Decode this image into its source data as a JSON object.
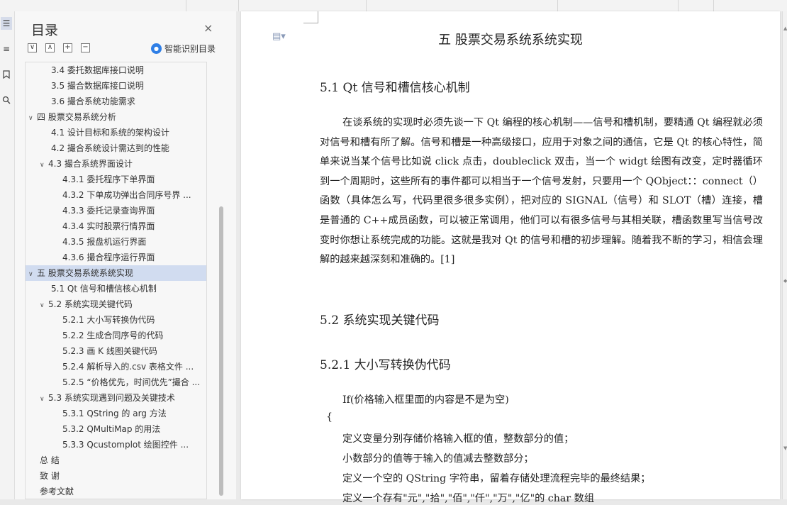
{
  "nav": {
    "title": "目录",
    "close": "×",
    "tools": [
      "∨",
      "∧",
      "+",
      "−"
    ],
    "smart_label": "智能识别目录",
    "smart_icon": "ai-icon",
    "items": [
      {
        "text": "3.4  委托数据库接口说明",
        "level": 2
      },
      {
        "text": "3.5  撮合数据库接口说明",
        "level": 2
      },
      {
        "text": "3.6  撮合系统功能需求",
        "level": 2
      },
      {
        "text": "四  股票交易系统分析",
        "level": 1,
        "expanded": true
      },
      {
        "text": "4.1  设计目标和系统的架构设计",
        "level": 2
      },
      {
        "text": "4.2  撮合系统设计需达到的性能",
        "level": 2
      },
      {
        "text": "4.3  撮合系统界面设计",
        "level": 2,
        "expanded": true
      },
      {
        "text": "4.3.1  委托程序下单界面",
        "level": 3
      },
      {
        "text": "4.3.2  下单成功弹出合同序号界 ...",
        "level": 3
      },
      {
        "text": "4.3.3  委托记录查询界面",
        "level": 3
      },
      {
        "text": "4.3.4  实时股票行情界面",
        "level": 3
      },
      {
        "text": "4.3.5  报盘机运行界面",
        "level": 3
      },
      {
        "text": "4.3.6  撮合程序运行界面",
        "level": 3
      },
      {
        "text": "五  股票交易系统系统实现",
        "level": 1,
        "expanded": true,
        "selected": true
      },
      {
        "text": "5.1 Qt 信号和槽信核心机制",
        "level": 2
      },
      {
        "text": "5.2  系统实现关键代码",
        "level": 2,
        "expanded": true
      },
      {
        "text": "5.2.1  大小写转换伪代码",
        "level": 3
      },
      {
        "text": "5.2.2  生成合同序号的代码",
        "level": 3
      },
      {
        "text": "5.2.3  画 K 线图关键代码",
        "level": 3
      },
      {
        "text": "5.2.4  解析导入的.csv 表格文件 ...",
        "level": 3
      },
      {
        "text": "5.2.5 “价格优先，时间优先”撮合 ...",
        "level": 3
      },
      {
        "text": "5.3  系统实现遇到问题及关键技术",
        "level": 2,
        "expanded": true
      },
      {
        "text": "5.3.1   QString 的 arg 方法",
        "level": 3
      },
      {
        "text": "5.3.2   QMultiMap 的用法",
        "level": 3
      },
      {
        "text": "5.3.3   Qcustomplot 绘图控件 ...",
        "level": 3
      },
      {
        "text": "总  结",
        "level": 1
      },
      {
        "text": "致  谢",
        "level": 1
      },
      {
        "text": "参考文献",
        "level": 1
      }
    ]
  },
  "document": {
    "chapter_title": "五  股票交易系统系统实现",
    "section_5_1": "5.1 Qt 信号和槽信核心机制",
    "paragraph": "在谈系统的实现时必须先谈一下 Qt 编程的核心机制——信号和槽机制，要精通 Qt 编程就必须对信号和槽有所了解。信号和槽是一种高级接口，应用于对象之间的通信，它是 Qt 的核心特性，简单来说当某个信号比如说 click 点击，doubleclick 双击，当一个 widgt 绘图有改变，定时器循环到一个周期时，这些所有的事件都可以相当于一个信号发射，只要用一个 QObject：：connect（）函数（具体怎么写，代码里很多很多实例），把对应的 SIGNAL（信号）和 SLOT（槽）连接，槽是普通的 C++成员函数，可以被正常调用，他们可以有很多信号与其相关联，槽函数里写当信号改变时你想让系统完成的功能。这就是我对 Qt 的信号和槽的初步理解。随着我不断的学习，相信会理解的越来越深刻和准确的。[1]",
    "section_5_2": "5.2  系统实现关键代码",
    "section_5_2_1": "5.2.1  大小写转换伪代码",
    "code_lines": [
      "If(价格输入框里面的内容是不是为空)",
      "{",
      "定义变量分别存储价格输入框的值，整数部分的值；",
      "小数部分的值等于输入的值减去整数部分；",
      "定义一个空的 QString 字符串，留着存储处理流程完毕的最终结果；",
      "定义一个存有\"元\",\"拾\",\"佰\",\"仟\",\"万\",\"亿\"的 char 数组"
    ]
  },
  "left_icons": [
    "toc-icon",
    "outline-icon",
    "bookmark-icon",
    "search-icon"
  ],
  "colors": {
    "selected_row": "#d1dcf0",
    "smart_icon": "#2f7fe6"
  }
}
